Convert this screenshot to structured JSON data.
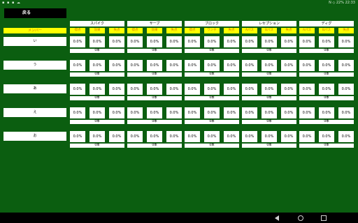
{
  "status_bar": {
    "left_icons": "▪ ▪ ▪ ☁",
    "right_text": "N ◇ 22% 22:33"
  },
  "back_button": {
    "label": "戻る"
  },
  "member_header": "メンバー",
  "categories": [
    {
      "name": "スパイク",
      "subs": [
        "得点",
        "効果",
        "失点"
      ]
    },
    {
      "name": "サーブ",
      "subs": [
        "得点",
        "効果",
        "失点"
      ]
    },
    {
      "name": "ブロック",
      "subs": [
        "得点",
        "ワンチ",
        "失点"
      ]
    },
    {
      "name": "レセプション",
      "subs": [
        "Aパス",
        "Bパス",
        "失点"
      ]
    },
    {
      "name": "ディグ",
      "subs": [
        "Aパス",
        "Bパス",
        "失点"
      ]
    }
  ],
  "members": [
    {
      "name": "い",
      "cells": [
        [
          "0.0%",
          "0.0%",
          "0.0%"
        ],
        [
          "0.0%",
          "0.0%",
          "0.0%"
        ],
        [
          "0.0%",
          "0.0%",
          "0.0%"
        ],
        [
          "0.0%",
          "0.0%",
          "0.0%"
        ],
        [
          "0.0%",
          "0.0%",
          "0.0%"
        ]
      ],
      "counts": [
        "0本",
        "0本",
        "0本",
        "0本",
        "0本"
      ]
    },
    {
      "name": "う",
      "cells": [
        [
          "0.0%",
          "0.0%",
          "0.0%"
        ],
        [
          "0.0%",
          "0.0%",
          "0.0%"
        ],
        [
          "0.0%",
          "0.0%",
          "0.0%"
        ],
        [
          "0.0%",
          "0.0%",
          "0.0%"
        ],
        [
          "0.0%",
          "0.0%",
          "0.0%"
        ]
      ],
      "counts": [
        "0本",
        "0本",
        "0本",
        "0本",
        "0本"
      ]
    },
    {
      "name": "あ",
      "cells": [
        [
          "0.0%",
          "0.0%",
          "0.0%"
        ],
        [
          "0.0%",
          "0.0%",
          "0.0%"
        ],
        [
          "0.0%",
          "0.0%",
          "0.0%"
        ],
        [
          "0.0%",
          "0.0%",
          "0.0%"
        ],
        [
          "0.0%",
          "0.0%",
          "0.0%"
        ]
      ],
      "counts": [
        "0本",
        "0本",
        "0本",
        "0本",
        "0本"
      ]
    },
    {
      "name": "え",
      "cells": [
        [
          "0.0%",
          "0.0%",
          "0.0%"
        ],
        [
          "0.0%",
          "0.0%",
          "0.0%"
        ],
        [
          "0.0%",
          "0.0%",
          "0.0%"
        ],
        [
          "0.0%",
          "0.0%",
          "0.0%"
        ],
        [
          "0.0%",
          "0.0%",
          "0.0%"
        ]
      ],
      "counts": [
        "0本",
        "0本",
        "0本",
        "0本",
        "0本"
      ]
    },
    {
      "name": "お",
      "cells": [
        [
          "0.0%",
          "0.0%",
          "0.0%"
        ],
        [
          "0.0%",
          "0.0%",
          "0.0%"
        ],
        [
          "0.0%",
          "0.0%",
          "0.0%"
        ],
        [
          "0.0%",
          "0.0%",
          "0.0%"
        ],
        [
          "0.0%",
          "0.0%",
          "0.0%"
        ]
      ],
      "counts": [
        "0本",
        "0本",
        "0本",
        "0本",
        "0本"
      ]
    }
  ],
  "colors": {
    "background": "#0b5e10",
    "header_yellow": "#ffff00",
    "header_text": "#d46a00"
  },
  "nav": {
    "back_icon": "triangle-back-icon",
    "home_icon": "circle-home-icon",
    "recent_icon": "square-recent-icon"
  }
}
